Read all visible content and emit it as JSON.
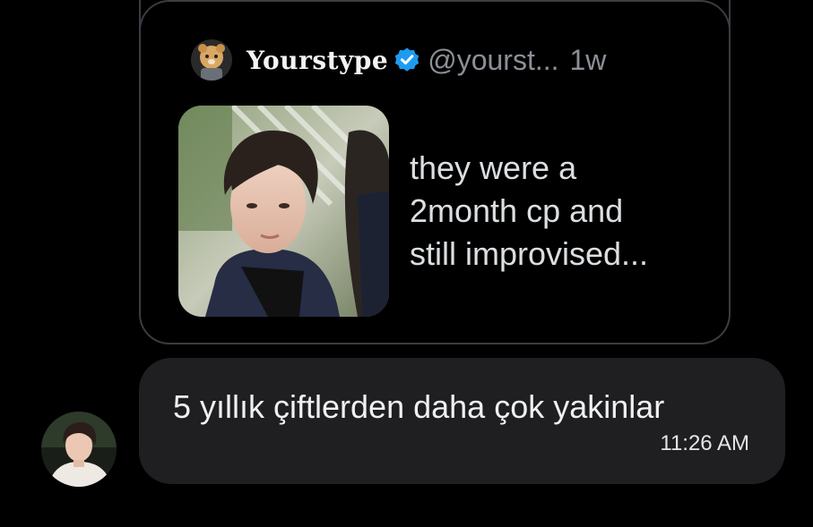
{
  "quoted_post": {
    "author_name": "Yourstype",
    "handle": "@yourst...",
    "time": "1w",
    "text_lines": [
      "they were a",
      "2month cp and",
      "still improvised..."
    ],
    "verified": true,
    "icons": {
      "avatar": "mascot-avatar-icon",
      "verified": "verified-badge-icon"
    },
    "media": "photo-thumbnail"
  },
  "reply_message": {
    "text": "5 yıllık çiftlerden daha çok yakinlar",
    "time": "11:26 AM",
    "avatar": "user-avatar"
  },
  "colors": {
    "background": "#000000",
    "card_border": "#3a3d42",
    "bubble_background": "#1f1f21",
    "verified_blue": "#1d9bf0",
    "muted_text": "#8b9096"
  }
}
